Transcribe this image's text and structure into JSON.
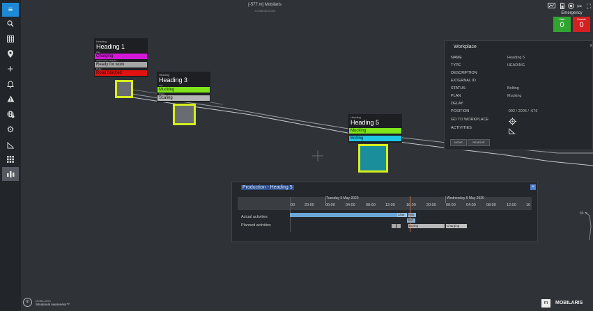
{
  "header": {
    "title": "[-577 m] Mobilaris",
    "subtitle": "-0.04/0.04/-0.022"
  },
  "sidebar": {
    "items": [
      {
        "name": "menu-icon",
        "glyph": "≡"
      },
      {
        "name": "search-icon",
        "glyph": "⚲"
      },
      {
        "name": "grid-icon",
        "glyph": "▦"
      },
      {
        "name": "location-pin-icon",
        "glyph": "⚲"
      },
      {
        "name": "plus-icon",
        "glyph": "+"
      },
      {
        "name": "bell-icon",
        "glyph": "🔔"
      },
      {
        "name": "warning-icon",
        "glyph": "▲"
      },
      {
        "name": "globe-settings-icon",
        "glyph": "⊛"
      },
      {
        "name": "gear-icon",
        "glyph": "⚙"
      },
      {
        "name": "slope-icon",
        "glyph": "◺"
      },
      {
        "name": "apps-icon",
        "glyph": "▦"
      },
      {
        "name": "production-icon",
        "glyph": "▮▮"
      }
    ]
  },
  "emergency": {
    "title": "Emergency",
    "safe_label": "Safe",
    "safe_value": "0",
    "unsafe_label": "Unsafe",
    "unsafe_value": "0",
    "safe_color": "#2fa52f",
    "unsafe_color": "#d42020"
  },
  "cards": {
    "h1": {
      "kind": "Heading",
      "name": "Heading 1",
      "plan_label": "Plan",
      "plan": "Charging",
      "status_label": "Status before delayed",
      "status": "Ready for work",
      "delay_label": "Delay",
      "delay": "Road blocked"
    },
    "h3": {
      "kind": "Heading",
      "name": "Heading 3",
      "plan_label": "Plan",
      "plan": "Mucking",
      "status_label": "Status",
      "status": "Scaling"
    },
    "h5": {
      "kind": "Heading",
      "name": "Heading 5",
      "plan": "Mucking",
      "status": "Bolting"
    }
  },
  "workplace": {
    "title": "Workplace",
    "rows": [
      {
        "key": "NAME",
        "value": "Heading 5"
      },
      {
        "key": "TYPE",
        "value": "HEADING"
      },
      {
        "key": "DESCRIPTION",
        "value": ""
      },
      {
        "key": "EXTERNAL ID",
        "value": ""
      },
      {
        "key": "STATUS",
        "value": "Bolting"
      },
      {
        "key": "PLAN",
        "value": "Mucking"
      },
      {
        "key": "DELAY",
        "value": ""
      },
      {
        "key": "POSITION",
        "value": "-992 / 2006 / -676"
      },
      {
        "key": "GO TO WORKPLACE",
        "value": ""
      },
      {
        "key": "ACTIVITIES",
        "value": ""
      }
    ],
    "btn_move": "MOVE",
    "btn_remove": "REMOVE"
  },
  "production": {
    "title": "Production - Heading 5",
    "date1": "Tuesday 5 May 2020",
    "date2": "Wednesday 6 May 2020",
    "ticks": [
      "00",
      "20:00",
      "00:00",
      "04:00",
      "08:00",
      "12:00",
      "16:00",
      "20:00",
      "00:00",
      "04:00",
      "08:00",
      "12:00",
      "16"
    ],
    "actual_label": "Actual activities",
    "planned_label": "Planned activities",
    "seg_actual_b": "Char",
    "seg_actual_c": "Res",
    "seg_actual_d": "Bolt",
    "seg_planned_b": "Boring",
    "seg_planned_c": "Charging"
  },
  "scale_label": "86 m",
  "footer": {
    "left_brand": "MOBILARIS",
    "left_product": "Situational Awareness™",
    "right_brand": "MOBILARIS"
  }
}
